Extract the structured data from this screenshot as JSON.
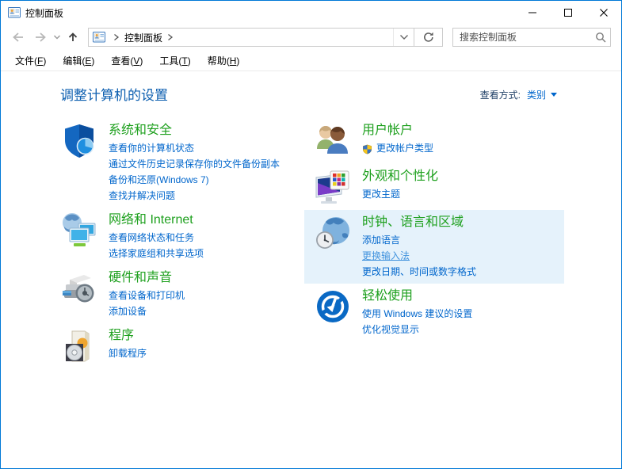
{
  "window": {
    "title": "控制面板",
    "controls": [
      {
        "name": "minimize"
      },
      {
        "name": "maximize"
      },
      {
        "name": "close"
      }
    ]
  },
  "navbar": {
    "breadcrumb_root": "控制面板",
    "search_placeholder": "搜索控制面板"
  },
  "menubar": {
    "items": [
      {
        "name": "file",
        "label": "文件",
        "key": "F"
      },
      {
        "name": "edit",
        "label": "编辑",
        "key": "E"
      },
      {
        "name": "view",
        "label": "查看",
        "key": "V"
      },
      {
        "name": "tools",
        "label": "工具",
        "key": "T"
      },
      {
        "name": "help",
        "label": "帮助",
        "key": "H"
      }
    ]
  },
  "page": {
    "heading": "调整计算机的设置",
    "view_by_label": "查看方式:",
    "view_by_value": "类别"
  },
  "categories": {
    "left": [
      {
        "name": "system-and-security",
        "icon": "shield-icon",
        "title": "系统和安全",
        "links": [
          "查看你的计算机状态",
          "通过文件历史记录保存你的文件备份副本",
          "备份和还原(Windows 7)",
          "查找并解决问题"
        ]
      },
      {
        "name": "network-and-internet",
        "icon": "globe-monitors-icon",
        "title": "网络和 Internet",
        "links": [
          "查看网络状态和任务",
          "选择家庭组和共享选项"
        ]
      },
      {
        "name": "hardware-and-sound",
        "icon": "printer-icon",
        "title": "硬件和声音",
        "links": [
          "查看设备和打印机",
          "添加设备"
        ]
      },
      {
        "name": "programs",
        "icon": "software-box-cd-icon",
        "title": "程序",
        "links": [
          "卸载程序"
        ]
      }
    ],
    "right": [
      {
        "name": "user-accounts",
        "icon": "two-users-icon",
        "title": "用户帐户",
        "links": [
          "更改帐户类型"
        ],
        "shield_first_link": true
      },
      {
        "name": "appearance-and-personalization",
        "icon": "monitor-palette-icon",
        "title": "外观和个性化",
        "links": [
          "更改主题"
        ]
      },
      {
        "name": "clock-language-region",
        "icon": "globe-clock-icon",
        "title": "时钟、语言和区域",
        "links": [
          "添加语言",
          "更换输入法",
          "更改日期、时间或数字格式"
        ],
        "highlighted": true,
        "hover_link_index": 1
      },
      {
        "name": "ease-of-access",
        "icon": "ease-of-access-icon",
        "title": "轻松使用",
        "links": [
          "使用 Windows 建议的设置",
          "优化视觉显示"
        ]
      }
    ]
  },
  "colors": {
    "accent_border": "#0078D7",
    "category_title_green": "#1EA01E",
    "link_blue": "#0066CC",
    "link_hover_blue": "#4394DE",
    "heading_blue": "#0D5FB0",
    "view_by_label": "#1F3F66",
    "highlight_bg": "#E5F2FB"
  }
}
